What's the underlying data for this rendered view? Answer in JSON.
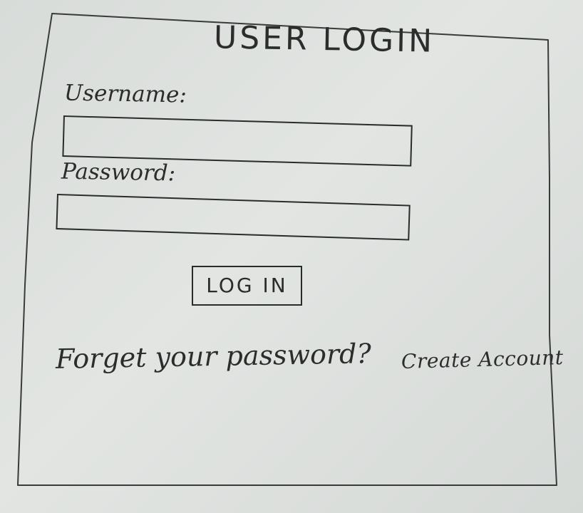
{
  "login": {
    "title": "USER LOGIN",
    "username_label": "Username:",
    "username_value": "",
    "password_label": "Password:",
    "password_value": "",
    "submit_label": "LOG IN",
    "forgot_label": "Forget your password?",
    "create_account_label": "Create Account"
  }
}
